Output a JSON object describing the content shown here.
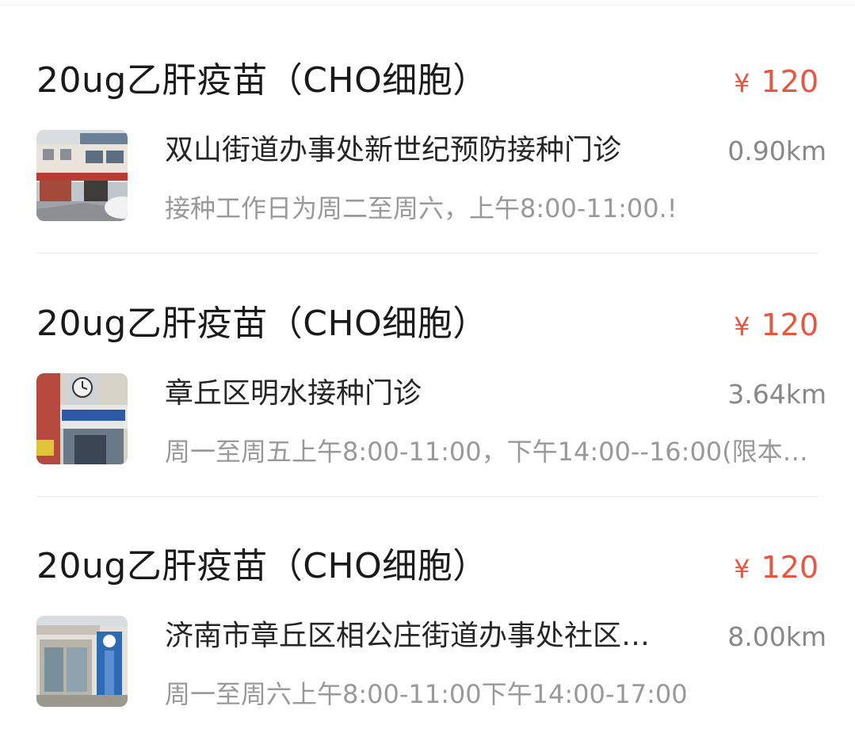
{
  "listings": [
    {
      "vaccine_title": "20ug乙肝疫苗（CHO细胞）",
      "currency": "¥",
      "price": "120",
      "clinic_name": "双山街道办事处新世纪预防接种门诊",
      "distance": "0.90km",
      "hours": "接种工作日为周二至周六，上午8:00-11:00.!",
      "thumbnail": "clinic-building-photo"
    },
    {
      "vaccine_title": "20ug乙肝疫苗（CHO细胞）",
      "currency": "¥",
      "price": "120",
      "clinic_name": "章丘区明水接种门诊",
      "distance": "3.64km",
      "hours": "周一至周五上午8:00-11:00，下午14:00--16:00(限本站…",
      "thumbnail": "clinic-building-photo"
    },
    {
      "vaccine_title": "20ug乙肝疫苗（CHO细胞）",
      "currency": "¥",
      "price": "120",
      "clinic_name": "济南市章丘区相公庄街道办事处社区…",
      "distance": "8.00km",
      "hours": "周一至周六上午8:00-11:00下午14:00-17:00",
      "thumbnail": "clinic-building-photo"
    }
  ],
  "colors": {
    "price": "#e9553f",
    "title": "#1a1a1a",
    "secondary": "#999999"
  }
}
